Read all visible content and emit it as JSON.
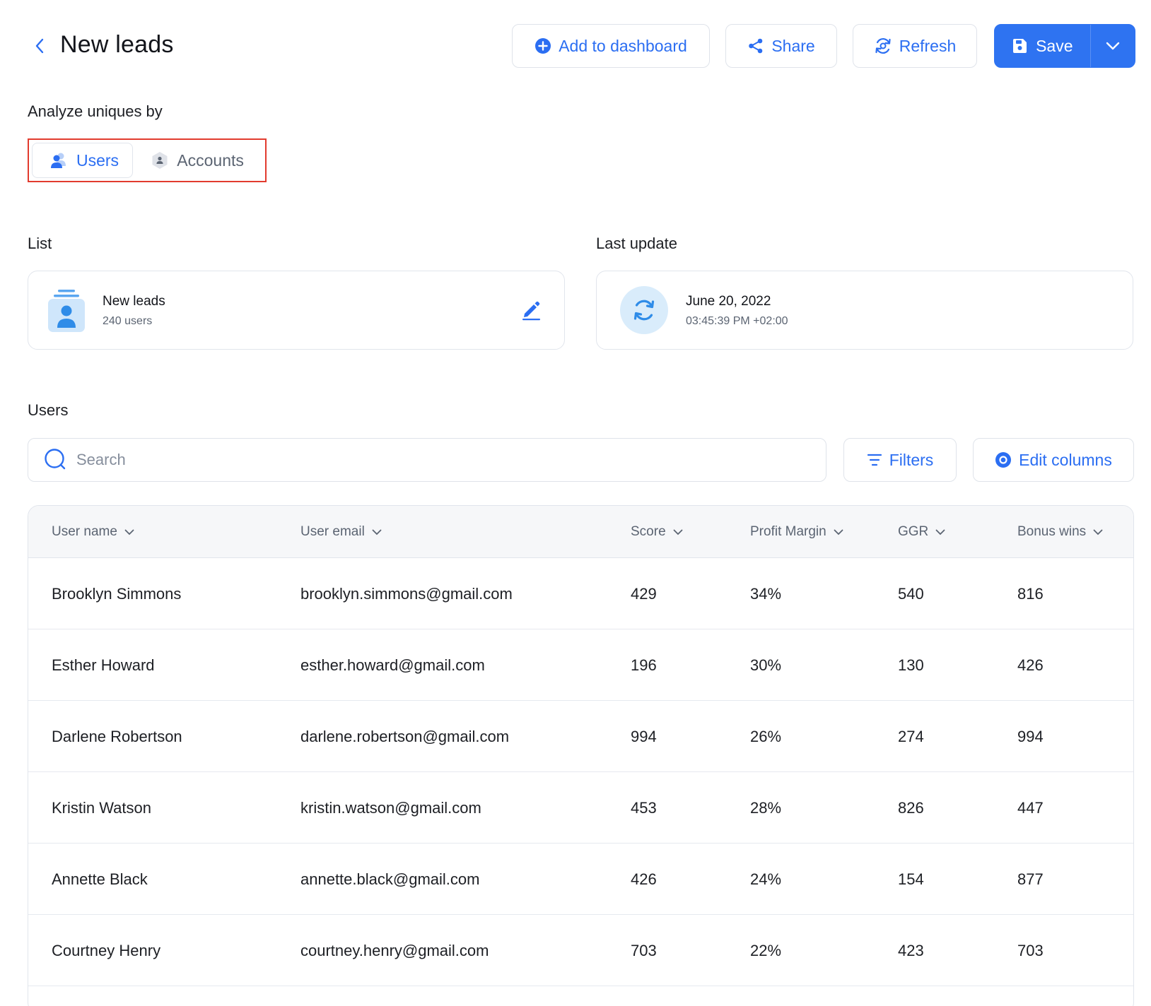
{
  "header": {
    "title": "New leads",
    "add_label": "Add to dashboard",
    "share_label": "Share",
    "refresh_label": "Refresh",
    "save_label": "Save"
  },
  "analyze": {
    "label": "Analyze uniques by",
    "options": [
      "Users",
      "Accounts"
    ],
    "selected": "Users"
  },
  "list_section": {
    "label": "List",
    "name": "New leads",
    "count": "240 users"
  },
  "update_section": {
    "label": "Last update",
    "date": "June 20, 2022",
    "time": "03:45:39 PM +02:00"
  },
  "users_section": {
    "label": "Users",
    "search_placeholder": "Search",
    "filters_label": "Filters",
    "edit_columns_label": "Edit columns"
  },
  "table": {
    "columns": [
      "User name",
      "User email",
      "Score",
      "Profit Margin",
      "GGR",
      "Bonus wins"
    ],
    "rows": [
      [
        "Brooklyn Simmons",
        "brooklyn.simmons@gmail.com",
        "429",
        "34%",
        "540",
        "816"
      ],
      [
        "Esther Howard",
        "esther.howard@gmail.com",
        "196",
        "30%",
        "130",
        "426"
      ],
      [
        "Darlene Robertson",
        "darlene.robertson@gmail.com",
        "994",
        "26%",
        "274",
        "994"
      ],
      [
        "Kristin Watson",
        "kristin.watson@gmail.com",
        "453",
        "28%",
        "826",
        "447"
      ],
      [
        "Annette Black",
        "annette.black@gmail.com",
        "426",
        "24%",
        "154",
        "877"
      ],
      [
        "Courtney Henry",
        "courtney.henry@gmail.com",
        "703",
        "22%",
        "423",
        "703"
      ]
    ]
  },
  "colors": {
    "accent": "#2e73f1",
    "highlight_border": "#e23b2e"
  }
}
